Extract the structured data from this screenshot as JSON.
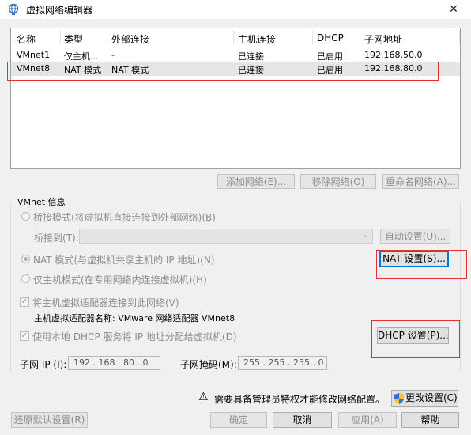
{
  "window": {
    "title": "虚拟网络编辑器",
    "close": "✕"
  },
  "list": {
    "columns": [
      "名称",
      "类型",
      "外部连接",
      "主机连接",
      "DHCP",
      "子网地址"
    ],
    "rows": [
      {
        "name": "VMnet1",
        "type": "仅主机...",
        "external": "-",
        "host": "已连接",
        "dhcp": "已启用",
        "subnet": "192.168.50.0"
      },
      {
        "name": "VMnet8",
        "type": "NAT 模式",
        "external": "NAT 模式",
        "host": "已连接",
        "dhcp": "已启用",
        "subnet": "192.168.80.0"
      }
    ]
  },
  "list_buttons": {
    "add": "添加网络(E)...",
    "remove": "移除网络(O)",
    "rename": "重命名网络(A)..."
  },
  "vmnet_info": {
    "title": "VMnet 信息",
    "bridge_mode": "桥接模式(将虚拟机直接连接到外部网络)(B)",
    "bridge_to_label": "桥接到(T):",
    "auto_settings": "自动设置(U)...",
    "nat_mode": "NAT 模式(与虚拟机共享主机的 IP 地址)(N)",
    "nat_settings": "NAT 设置(S)...",
    "host_only_mode": "仅主机模式(在专用网络内连接虚拟机)(H)",
    "connect_adapter": "将主机虚拟适配器连接到此网络(V)",
    "adapter_name": "主机虚拟适配器名称: VMware 网络适配器 VMnet8",
    "use_dhcp": "使用本地 DHCP 服务将 IP 地址分配给虚拟机(D)",
    "dhcp_settings": "DHCP 设置(P)...",
    "subnet_ip_label": "子网 IP (I):",
    "subnet_ip": "192 . 168 . 80 . 0",
    "subnet_mask_label": "子网掩码(M):",
    "subnet_mask": "255 . 255 . 255 . 0"
  },
  "admin_notice": "需要具备管理员特权才能修改网络配置。",
  "change_settings": "更改设置(C)",
  "footer": {
    "restore": "还原默认设置(R)",
    "ok": "确定",
    "cancel": "取消",
    "apply": "应用(A)",
    "help": "帮助"
  },
  "colors": {
    "highlight": "#e03030",
    "accent": "#0078d7"
  },
  "icons": {
    "title": "network-globe-icon",
    "warn": "warning-icon",
    "shield": "uac-shield-icon"
  }
}
